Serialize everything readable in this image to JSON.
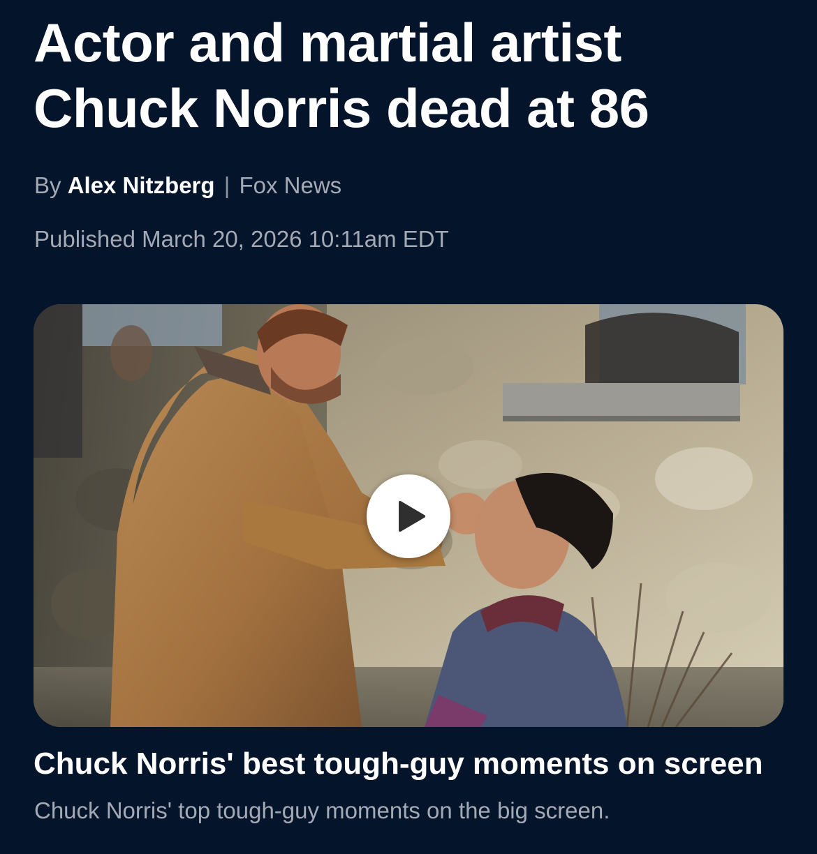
{
  "article": {
    "headline": "Actor and martial artist Chuck Norris dead at 86",
    "byline_prefix": "By",
    "author": "Alex Nitzberg",
    "separator": "|",
    "source": "Fox News",
    "published": "Published March 20, 2026 10:11am EDT"
  },
  "video": {
    "thumbnail_label": "video-thumbnail",
    "play_icon": "play-icon",
    "title": "Chuck Norris' best tough-guy moments on screen",
    "description": "Chuck Norris' top tough-guy moments on the big screen."
  },
  "colors": {
    "background": "#04142b",
    "primary_text": "#ffffff",
    "secondary_text": "#a3aab5"
  }
}
